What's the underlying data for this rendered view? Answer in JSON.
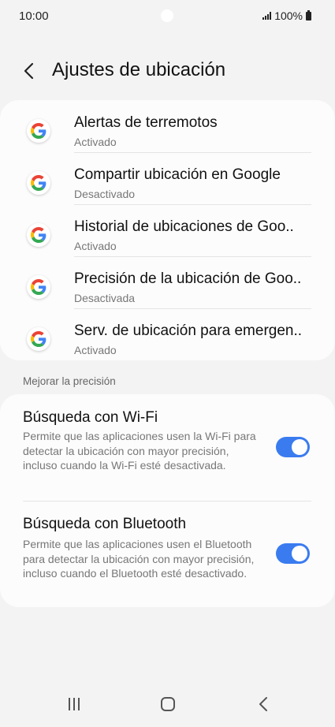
{
  "status_bar": {
    "time": "10:00",
    "battery": "100%"
  },
  "header": {
    "title": "Ajustes de ubicación"
  },
  "google_services": [
    {
      "title": "Alertas de terremotos",
      "status": "Activado"
    },
    {
      "title": "Compartir ubicación en Google",
      "status": "Desactivado"
    },
    {
      "title": "Historial de ubicaciones de Goo..",
      "status": "Activado"
    },
    {
      "title": "Precisión de la ubicación de Goo..",
      "status": "Desactivada"
    },
    {
      "title": "Serv. de ubicación para emergen..",
      "status": "Activado"
    }
  ],
  "section": {
    "label": "Mejorar la precisión"
  },
  "toggles": [
    {
      "title": "Búsqueda con Wi-Fi",
      "description": "Permite que las aplicaciones usen la Wi-Fi para detectar la ubicación con mayor precisión, incluso cuando la Wi-Fi esté desactivada.",
      "on": true
    },
    {
      "title": "Búsqueda con Bluetooth",
      "description": "Permite que las aplicaciones usen el Bluetooth para detectar la ubicación con mayor precisión, incluso cuando el Bluetooth esté desactivado.",
      "on": true
    }
  ],
  "colors": {
    "accent": "#3a7cf0",
    "background": "#f3f3f3",
    "card": "#fcfcfc"
  },
  "icons": {
    "back": "chevron-left-icon",
    "google": "google-g-icon",
    "recents": "recents-icon",
    "home": "home-icon",
    "nav_back": "back-icon"
  }
}
